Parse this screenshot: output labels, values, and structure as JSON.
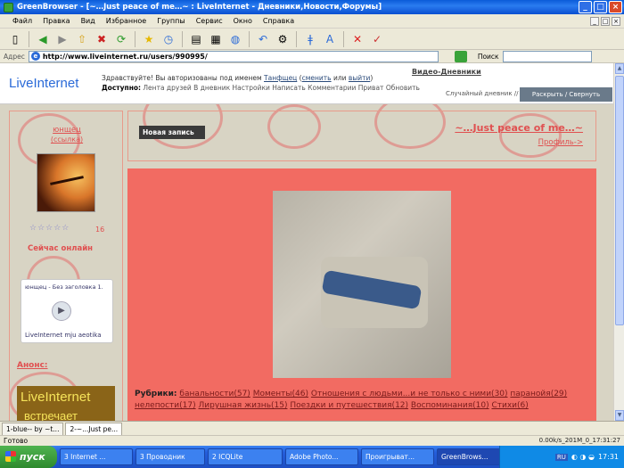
{
  "window": {
    "title": "GreenBrowser - [~…Just peace of me…~ : LiveInternet - Дневники,Новости,Форумы]"
  },
  "menu": [
    "Файл",
    "Правка",
    "Вид",
    "Избранное",
    "Группы",
    "Сервис",
    "Окно",
    "Справка"
  ],
  "address": {
    "label": "Адрес",
    "url": "http://www.liveinternet.ru/users/990995/",
    "search_label": "Поиск"
  },
  "site": {
    "logo": "LiveInternet",
    "welcome_prefix": "Здравствуйте! Вы авторизованы под именем",
    "user": "Танфщец",
    "change": "сменить",
    "or": "или",
    "logout": "выйти",
    "available_label": "Доступно:",
    "available_links": "Лента друзей В дневник Настройки Написать Комментарии Приват Обновить",
    "video_link": "Видео-Дневники",
    "tab_diary": "Случайный дневник //",
    "tab_expand": "Раскрыть / Свернуть"
  },
  "left": {
    "name": "юнщец",
    "status": "(ссылка)",
    "count": "16",
    "online": "Сейчас онлайн",
    "player_title": "юнщец - Без заголовка  1.",
    "player_footer": "LiveInternet  mju aeotika",
    "anons": "Анонс:",
    "banner_line1": "LiveInternet",
    "banner_line2": "встречает"
  },
  "blog": {
    "new_post": "Новая запись",
    "title": "~…Just peace of me…~",
    "profile": "Профиль->"
  },
  "rubrics": {
    "label": "Рубрики:",
    "items": [
      "банальности(57)",
      "Моменты(46)",
      "Отношения с людьми...и не только с ними(30)",
      "паранойя(29)",
      "нелепости(17)",
      "Лирушная жизнь(15)",
      "Поездки и путешествия(12)",
      "Воспоминания(10)",
      "Стихи(6)"
    ]
  },
  "tabs": [
    "1-blue-- by ~t...",
    "2-~...Just pe..."
  ],
  "status": {
    "text": "Готово",
    "right": "0.00k/s_201M_0_17:31:27"
  },
  "taskbar": {
    "start": "пуск",
    "tasks": [
      "3 Internet ...",
      "3 Проводник",
      "2 ICQLite",
      "Adobe Photo...",
      "Проигрыват...",
      "GreenBrows..."
    ],
    "lang": "RU",
    "time": "17:31"
  }
}
